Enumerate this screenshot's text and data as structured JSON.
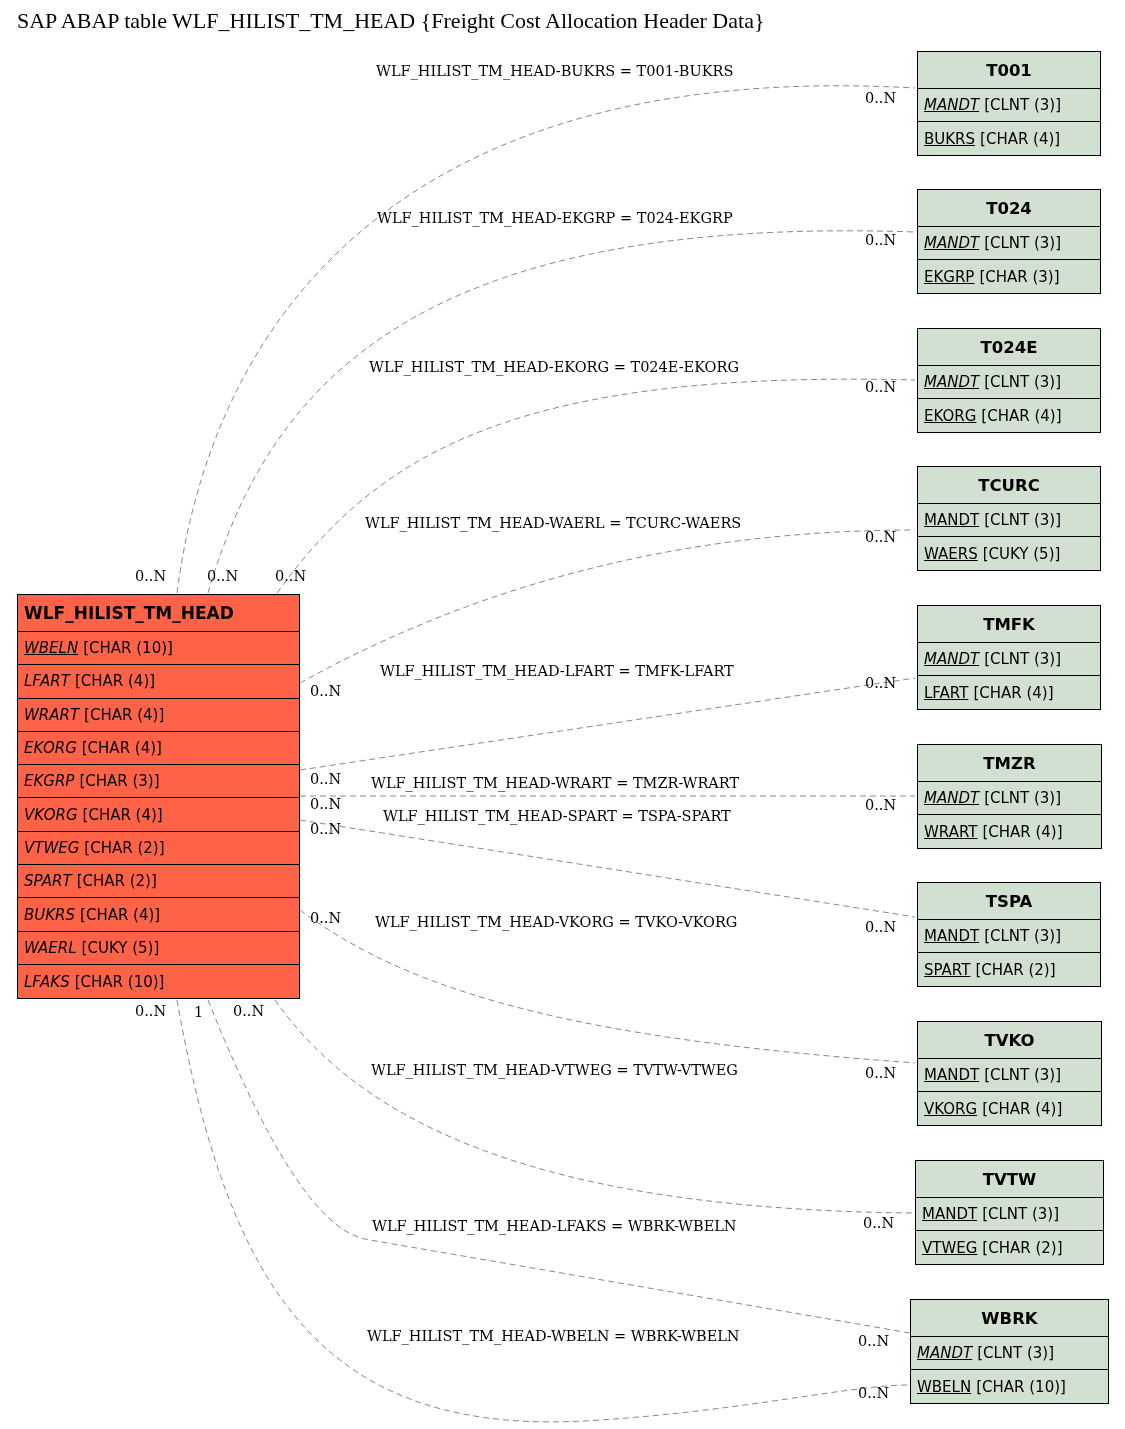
{
  "title": "SAP ABAP table WLF_HILIST_TM_HEAD {Freight Cost Allocation Header Data}",
  "main_table": {
    "name": "WLF_HILIST_TM_HEAD",
    "fields": [
      {
        "name": "WBELN",
        "type": "[CHAR (10)]",
        "key": true,
        "italic": true
      },
      {
        "name": "LFART",
        "type": "[CHAR (4)]",
        "key": false,
        "italic": true
      },
      {
        "name": "WRART",
        "type": "[CHAR (4)]",
        "key": false,
        "italic": true
      },
      {
        "name": "EKORG",
        "type": "[CHAR (4)]",
        "key": false,
        "italic": true
      },
      {
        "name": "EKGRP",
        "type": "[CHAR (3)]",
        "key": false,
        "italic": true
      },
      {
        "name": "VKORG",
        "type": "[CHAR (4)]",
        "key": false,
        "italic": true
      },
      {
        "name": "VTWEG",
        "type": "[CHAR (2)]",
        "key": false,
        "italic": true
      },
      {
        "name": "SPART",
        "type": "[CHAR (2)]",
        "key": false,
        "italic": true
      },
      {
        "name": "BUKRS",
        "type": "[CHAR (4)]",
        "key": false,
        "italic": true
      },
      {
        "name": "WAERL",
        "type": "[CUKY (5)]",
        "key": false,
        "italic": true
      },
      {
        "name": "LFAKS",
        "type": "[CHAR (10)]",
        "key": false,
        "italic": true
      }
    ],
    "link_cardinalities": [
      "0..N",
      "0..N",
      "0..N",
      "0..N",
      "0..N",
      "0..N",
      "0..N",
      "0..N",
      "0..N",
      "1",
      "0..N"
    ]
  },
  "tables": [
    {
      "name": "T001",
      "fields": [
        {
          "name": "MANDT",
          "type": "[CLNT (3)]",
          "key": true,
          "italic": true
        },
        {
          "name": "BUKRS",
          "type": "[CHAR (4)]",
          "key": true,
          "italic": false
        }
      ]
    },
    {
      "name": "T024",
      "fields": [
        {
          "name": "MANDT",
          "type": "[CLNT (3)]",
          "key": true,
          "italic": true
        },
        {
          "name": "EKGRP",
          "type": "[CHAR (3)]",
          "key": true,
          "italic": false
        }
      ]
    },
    {
      "name": "T024E",
      "fields": [
        {
          "name": "MANDT",
          "type": "[CLNT (3)]",
          "key": true,
          "italic": true
        },
        {
          "name": "EKORG",
          "type": "[CHAR (4)]",
          "key": true,
          "italic": false
        }
      ]
    },
    {
      "name": "TCURC",
      "fields": [
        {
          "name": "MANDT",
          "type": "[CLNT (3)]",
          "key": true,
          "italic": false
        },
        {
          "name": "WAERS",
          "type": "[CUKY (5)]",
          "key": true,
          "italic": false
        }
      ]
    },
    {
      "name": "TMFK",
      "fields": [
        {
          "name": "MANDT",
          "type": "[CLNT (3)]",
          "key": true,
          "italic": true
        },
        {
          "name": "LFART",
          "type": "[CHAR (4)]",
          "key": true,
          "italic": false
        }
      ]
    },
    {
      "name": "TMZR",
      "fields": [
        {
          "name": "MANDT",
          "type": "[CLNT (3)]",
          "key": true,
          "italic": true
        },
        {
          "name": "WRART",
          "type": "[CHAR (4)]",
          "key": true,
          "italic": false
        }
      ]
    },
    {
      "name": "TSPA",
      "fields": [
        {
          "name": "MANDT",
          "type": "[CLNT (3)]",
          "key": true,
          "italic": false
        },
        {
          "name": "SPART",
          "type": "[CHAR (2)]",
          "key": true,
          "italic": false
        }
      ]
    },
    {
      "name": "TVKO",
      "fields": [
        {
          "name": "MANDT",
          "type": "[CLNT (3)]",
          "key": true,
          "italic": false
        },
        {
          "name": "VKORG",
          "type": "[CHAR (4)]",
          "key": true,
          "italic": false
        }
      ]
    },
    {
      "name": "TVTW",
      "fields": [
        {
          "name": "MANDT",
          "type": "[CLNT (3)]",
          "key": true,
          "italic": false
        },
        {
          "name": "VTWEG",
          "type": "[CHAR (2)]",
          "key": true,
          "italic": false
        }
      ]
    },
    {
      "name": "WBRK",
      "fields": [
        {
          "name": "MANDT",
          "type": "[CLNT (3)]",
          "key": true,
          "italic": true
        },
        {
          "name": "WBELN",
          "type": "[CHAR (10)]",
          "key": true,
          "italic": false
        }
      ]
    }
  ],
  "relations": [
    {
      "label": "WLF_HILIST_TM_HEAD-BUKRS = T001-BUKRS",
      "card_to": "0..N"
    },
    {
      "label": "WLF_HILIST_TM_HEAD-EKGRP = T024-EKGRP",
      "card_to": "0..N"
    },
    {
      "label": "WLF_HILIST_TM_HEAD-EKORG = T024E-EKORG",
      "card_to": "0..N"
    },
    {
      "label": "WLF_HILIST_TM_HEAD-WAERL = TCURC-WAERS",
      "card_to": "0..N"
    },
    {
      "label": "WLF_HILIST_TM_HEAD-LFART = TMFK-LFART",
      "card_to": "0..N"
    },
    {
      "label": "WLF_HILIST_TM_HEAD-WRART = TMZR-WRART",
      "card_to": "0..N"
    },
    {
      "label": "WLF_HILIST_TM_HEAD-SPART = TSPA-SPART",
      "card_to": "0..N"
    },
    {
      "label": "WLF_HILIST_TM_HEAD-VKORG = TVKO-VKORG",
      "card_to": "0..N"
    },
    {
      "label": "WLF_HILIST_TM_HEAD-VTWEG = TVTW-VTWEG",
      "card_to": "0..N"
    },
    {
      "label": "WLF_HILIST_TM_HEAD-LFAKS = WBRK-WBELN",
      "card_to": "0..N"
    },
    {
      "label": "WLF_HILIST_TM_HEAD-WBELN = WBRK-WBELN",
      "card_to": "0..N"
    }
  ]
}
